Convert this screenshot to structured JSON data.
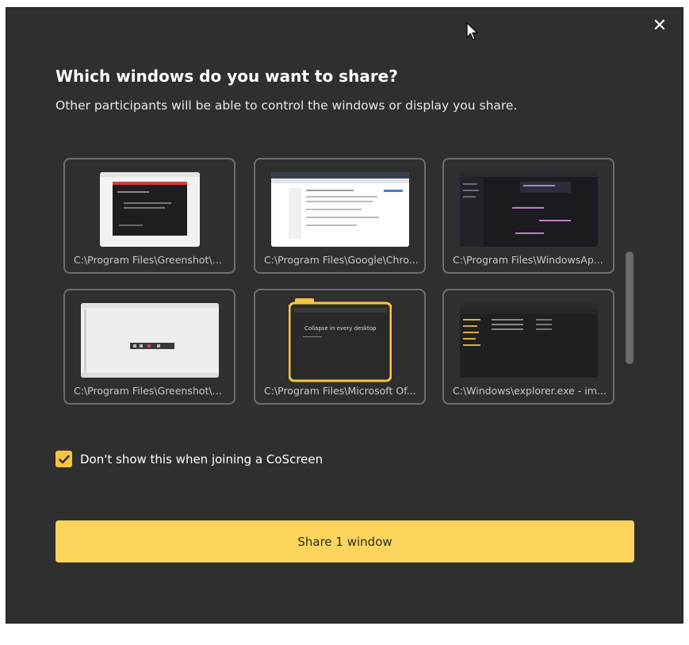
{
  "dialog": {
    "close_glyph": "✕",
    "title": "Which windows do you want to share?",
    "subtitle": "Other participants will be able to control the windows or display you share.",
    "windows": [
      {
        "label": "C:\\Program Files\\Greenshot\\G...",
        "selected": false,
        "thumb": "dark-app-in-light-frame"
      },
      {
        "label": "C:\\Program Files\\Google\\Chro...",
        "selected": false,
        "thumb": "browser-document"
      },
      {
        "label": "C:\\Program Files\\WindowsAp...",
        "selected": false,
        "thumb": "dark-code-editor"
      },
      {
        "label": "C:\\Program Files\\Greenshot\\G...",
        "selected": false,
        "thumb": "light-editor-toolbar"
      },
      {
        "label": "C:\\Program Files\\Microsoft Of...",
        "selected": true,
        "thumb": "dark-note"
      },
      {
        "label": "C:\\Windows\\explorer.exe - im...",
        "selected": false,
        "thumb": "file-explorer-dark"
      }
    ],
    "note_thumb_text": "Collapse in every desktop",
    "checkbox": {
      "checked": true,
      "label": "Don't show this when joining a CoScreen"
    },
    "share_button_label": "Share 1 window"
  },
  "colors": {
    "dialog_bg": "#2f2f2f",
    "accent": "#fdd55c",
    "selected_border": "#f5c542",
    "tile_border": "#6e6e6e"
  }
}
